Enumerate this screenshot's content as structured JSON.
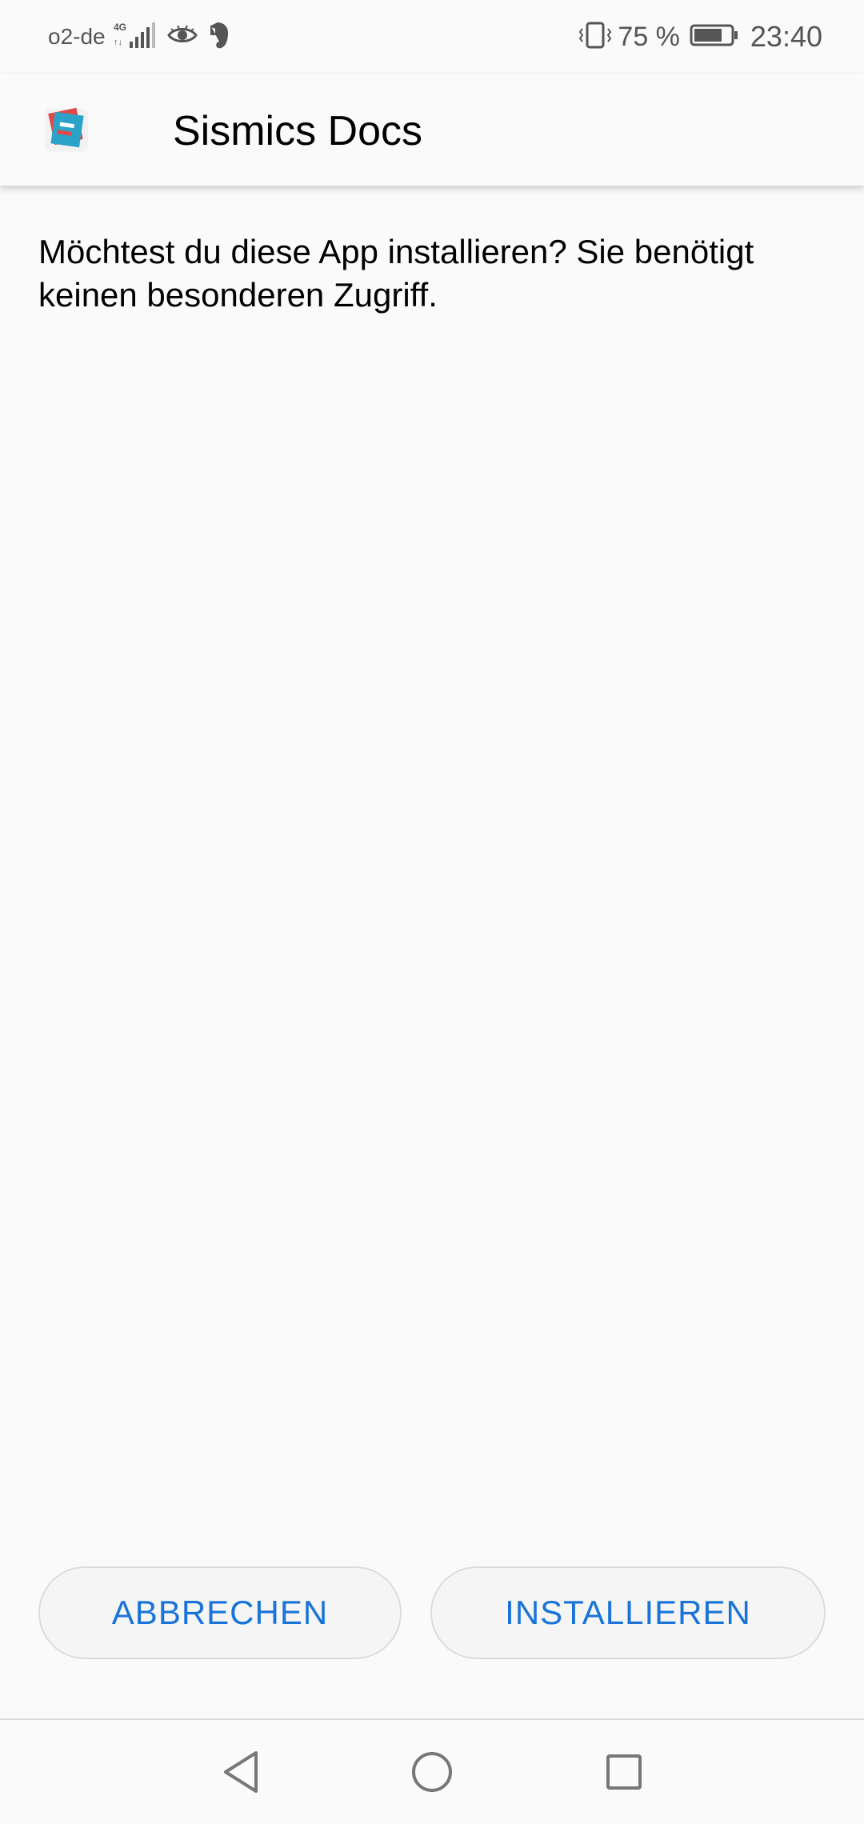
{
  "status_bar": {
    "carrier": "o2-de",
    "network_type": "4G",
    "battery_percent": "75 %",
    "time": "23:40",
    "icons": [
      "signal-icon",
      "eye-icon",
      "evernote-icon",
      "vibrate-icon",
      "battery-icon"
    ]
  },
  "header": {
    "app_name": "Sismics Docs",
    "icon": "sismics-docs-app-icon"
  },
  "message": "Möchtest du diese App installieren? Sie benötigt keinen besonderen Zugriff.",
  "buttons": {
    "cancel": "ABBRECHEN",
    "install": "INSTALLIEREN"
  },
  "nav": {
    "icons": [
      "back-icon",
      "home-icon",
      "recents-icon"
    ]
  },
  "colors": {
    "accent": "#1a74d8",
    "background": "#fafafa"
  }
}
